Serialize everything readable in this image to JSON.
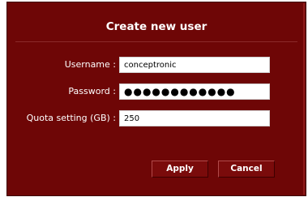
{
  "dialog": {
    "title": "Create new user",
    "fields": {
      "username": {
        "label": "Username :",
        "value": "conceptronic"
      },
      "password": {
        "label": "Password :",
        "value": "●●●●●●●●●●●●"
      },
      "quota": {
        "label": "Quota setting (GB) :",
        "value": "250"
      }
    },
    "buttons": {
      "apply": "Apply",
      "cancel": "Cancel"
    }
  },
  "colors": {
    "dialog_background": "#6e0606",
    "button_background": "#7a0b0b",
    "text": "#ffffff"
  }
}
